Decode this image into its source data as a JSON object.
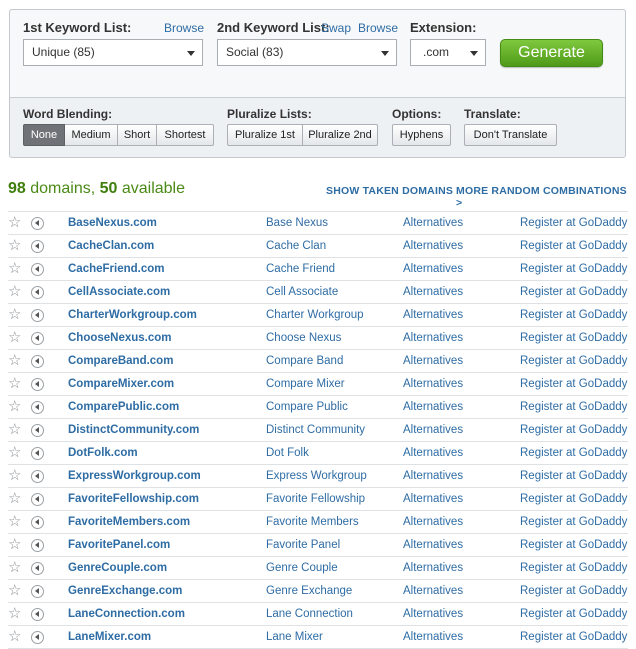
{
  "controls": {
    "list1": {
      "label": "1st Keyword List:",
      "browse": "Browse",
      "value": "Unique (85)"
    },
    "list2": {
      "label": "2nd Keyword List:",
      "swap": "Swap",
      "browse": "Browse",
      "value": "Social (83)"
    },
    "extension": {
      "label": "Extension:",
      "value": ".com"
    },
    "generate": "Generate",
    "blending": {
      "label": "Word Blending:",
      "options": [
        "None",
        "Medium",
        "Short",
        "Shortest"
      ],
      "selected": "None"
    },
    "pluralize": {
      "label": "Pluralize Lists:",
      "options": [
        "Pluralize 1st",
        "Pluralize 2nd"
      ]
    },
    "options": {
      "label": "Options:",
      "hyphens": "Hyphens"
    },
    "translate": {
      "label": "Translate:",
      "value": "Don't Translate"
    }
  },
  "summary": {
    "domains": "98",
    "domains_text": " domains, ",
    "available": "50",
    "available_text": " available"
  },
  "links": {
    "show_taken": "SHOW TAKEN DOMAINS",
    "more_random": "MORE RANDOM COMBINATIONS >"
  },
  "row_labels": {
    "alternatives": "Alternatives",
    "register": "Register at GoDaddy"
  },
  "colors": {
    "accent_green": "#5aa51f",
    "link_blue": "#2e6ca4",
    "count_green": "#3f7e0d"
  },
  "results": [
    {
      "domain": "BaseNexus.com",
      "words": "Base Nexus"
    },
    {
      "domain": "CacheClan.com",
      "words": "Cache Clan"
    },
    {
      "domain": "CacheFriend.com",
      "words": "Cache Friend"
    },
    {
      "domain": "CellAssociate.com",
      "words": "Cell Associate"
    },
    {
      "domain": "CharterWorkgroup.com",
      "words": "Charter Workgroup"
    },
    {
      "domain": "ChooseNexus.com",
      "words": "Choose Nexus"
    },
    {
      "domain": "CompareBand.com",
      "words": "Compare Band"
    },
    {
      "domain": "CompareMixer.com",
      "words": "Compare Mixer"
    },
    {
      "domain": "ComparePublic.com",
      "words": "Compare Public"
    },
    {
      "domain": "DistinctCommunity.com",
      "words": "Distinct Community"
    },
    {
      "domain": "DotFolk.com",
      "words": "Dot Folk"
    },
    {
      "domain": "ExpressWorkgroup.com",
      "words": "Express Workgroup"
    },
    {
      "domain": "FavoriteFellowship.com",
      "words": "Favorite Fellowship"
    },
    {
      "domain": "FavoriteMembers.com",
      "words": "Favorite Members"
    },
    {
      "domain": "FavoritePanel.com",
      "words": "Favorite Panel"
    },
    {
      "domain": "GenreCouple.com",
      "words": "Genre Couple"
    },
    {
      "domain": "GenreExchange.com",
      "words": "Genre Exchange"
    },
    {
      "domain": "LaneConnection.com",
      "words": "Lane Connection"
    },
    {
      "domain": "LaneMixer.com",
      "words": "Lane Mixer"
    }
  ]
}
